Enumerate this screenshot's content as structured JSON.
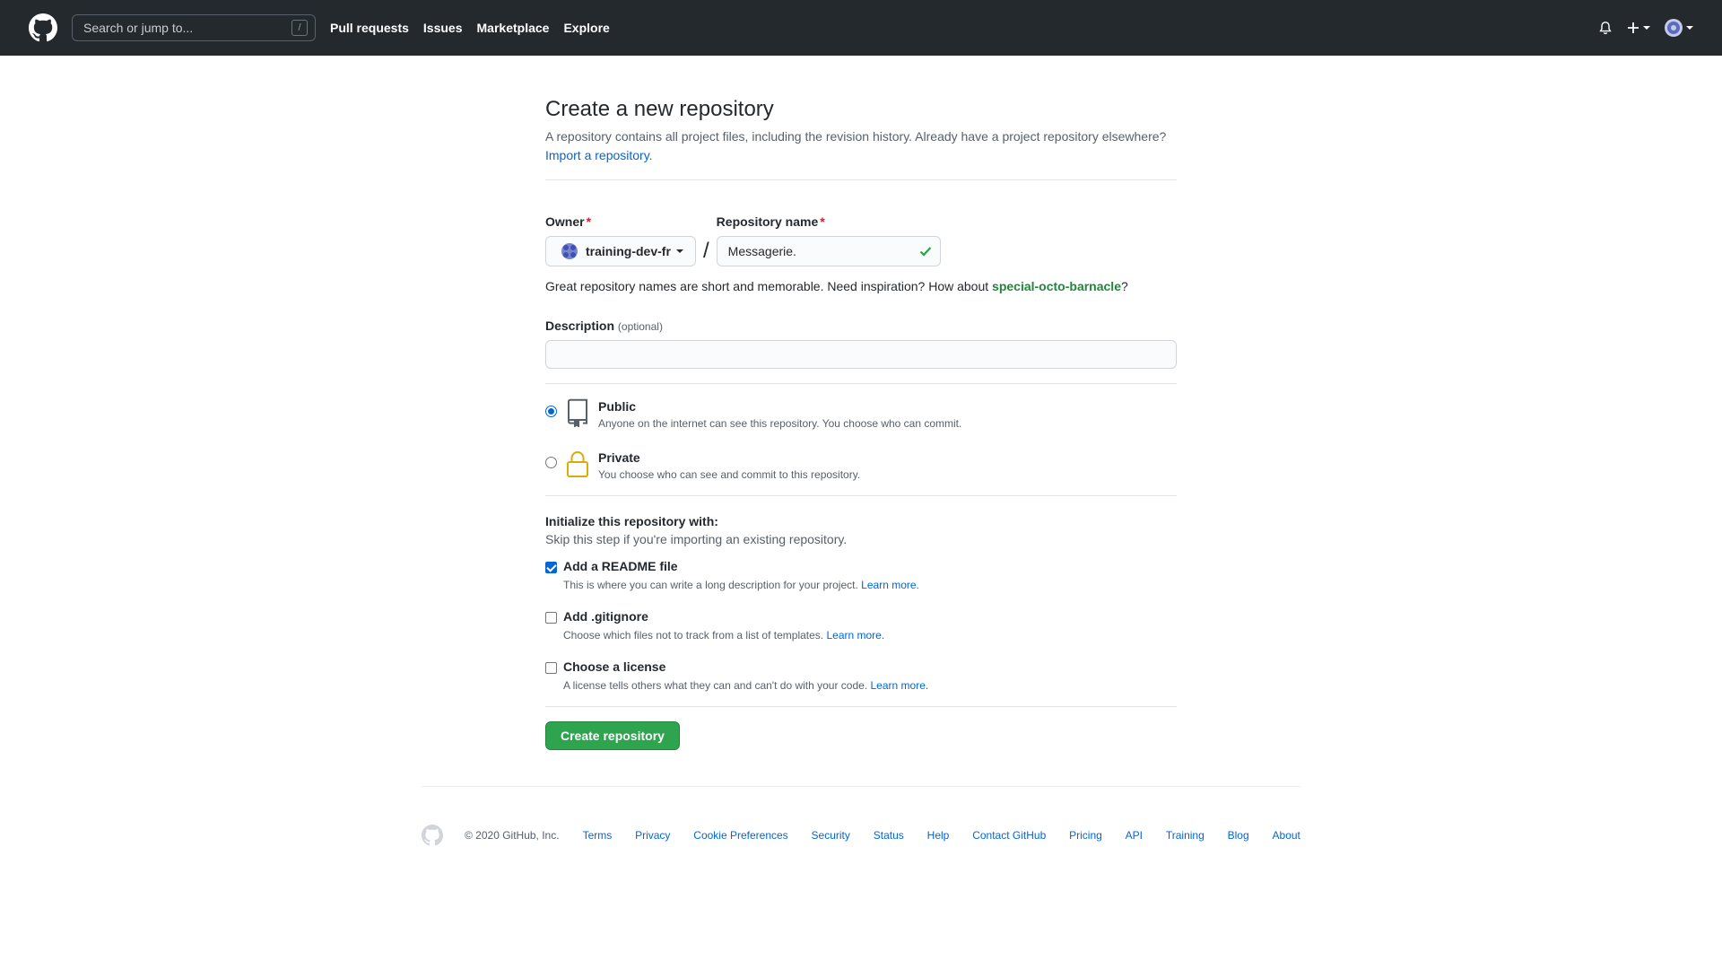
{
  "header": {
    "search_placeholder": "Search or jump to...",
    "search_shortcut": "/",
    "nav": [
      "Pull requests",
      "Issues",
      "Marketplace",
      "Explore"
    ]
  },
  "main": {
    "title": "Create a new repository",
    "subtitle": "A repository contains all project files, including the revision history. Already have a project repository elsewhere?",
    "import_link": "Import a repository.",
    "owner_label": "Owner",
    "owner_value": "training-dev-fr",
    "separator": "/",
    "repo_name_label": "Repository name",
    "repo_name_value": "Messagerie.",
    "required_mark": "*",
    "hint_prefix": "Great repository names are short and memorable. Need inspiration? How about",
    "hint_suggestion": "special-octo-barnacle",
    "hint_suffix": "?",
    "description_label": "Description",
    "description_optional": "(optional)",
    "description_value": "",
    "visibility": {
      "public_title": "Public",
      "public_desc": "Anyone on the internet can see this repository. You choose who can commit.",
      "private_title": "Private",
      "private_desc": "You choose who can see and commit to this repository.",
      "selected": "public"
    },
    "init": {
      "title": "Initialize this repository with:",
      "subtitle": "Skip this step if you're importing an existing repository.",
      "learn_more": "Learn more.",
      "options": [
        {
          "title": "Add a README file",
          "desc": "This is where you can write a long description for your project.",
          "checked": true
        },
        {
          "title": "Add .gitignore",
          "desc": "Choose which files not to track from a list of templates.",
          "checked": false
        },
        {
          "title": "Choose a license",
          "desc": "A license tells others what they can and can't do with your code.",
          "checked": false
        }
      ]
    },
    "create_button": "Create repository"
  },
  "footer": {
    "copyright": "© 2020 GitHub, Inc.",
    "links": [
      "Terms",
      "Privacy",
      "Cookie Preferences",
      "Security",
      "Status",
      "Help",
      "Contact GitHub",
      "Pricing",
      "API",
      "Training",
      "Blog",
      "About"
    ]
  },
  "colors": {
    "header_bg": "#24292e",
    "link": "#0366d6",
    "primary_button": "#2ea44f",
    "success_check": "#28a745",
    "lock_icon": "#dbab09"
  }
}
